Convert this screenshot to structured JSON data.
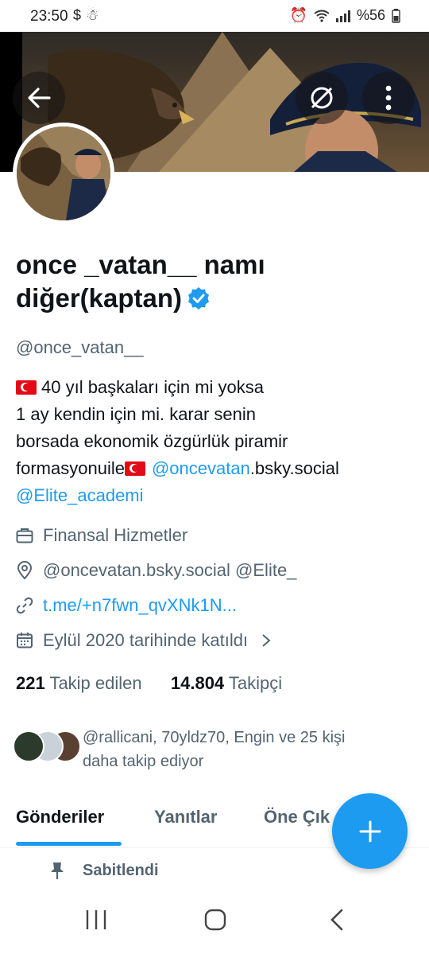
{
  "status_bar": {
    "time": "23:50",
    "left_icons": [
      "dollar-icon",
      "notification-icon"
    ],
    "battery": "%56",
    "right_icons": [
      "alarm-icon",
      "wifi-icon",
      "signal-icon",
      "battery-icon"
    ]
  },
  "profile": {
    "display_name": "once _vatan__ namı diğer(kaptan)",
    "verified": true,
    "handle": "@once_vatan__",
    "bio": {
      "line1": "40 yıl başkaları için mi yoksa",
      "line2": "1 ay kendin için mi.  karar  senin",
      "line3": "borsada ekonomik özgürlük piramir",
      "line4_start": "formasyonuile",
      "line4_link": "@oncevatan",
      "line4_end": ".bsky.social",
      "line5_link": "@Elite_academi"
    },
    "category": "Finansal Hizmetler",
    "location": "@oncevatan.bsky.social @Elite_",
    "website": "t.me/+n7fwn_qvXNk1N...",
    "joined": "Eylül 2020 tarihinde katıldı",
    "following_count": "221",
    "following_label": "Takip edilen",
    "followers_count": "14.804",
    "followers_label": "Takipçi",
    "followed_by_line1": "@rallicani, 70yldz70, Engin ve 25 kişi",
    "followed_by_line2": "daha takip ediyor"
  },
  "tabs": [
    {
      "label": "Gönderiler",
      "active": true
    },
    {
      "label": "Yanıtlar",
      "active": false
    },
    {
      "label": "Öne Çık",
      "active": false
    }
  ],
  "pinned_label": "Sabitlendi",
  "colors": {
    "accent": "#1d9bf0",
    "text_primary": "#0f1419",
    "text_secondary": "#536471",
    "flag_red": "#e30a17"
  },
  "icons": {
    "back": "arrow-left-icon",
    "lists": "lists-icon",
    "more": "more-vertical-icon",
    "category": "briefcase-icon",
    "location": "location-pin-icon",
    "website": "link-icon",
    "joined": "calendar-icon",
    "pinned": "pin-icon",
    "compose": "plus-icon"
  }
}
